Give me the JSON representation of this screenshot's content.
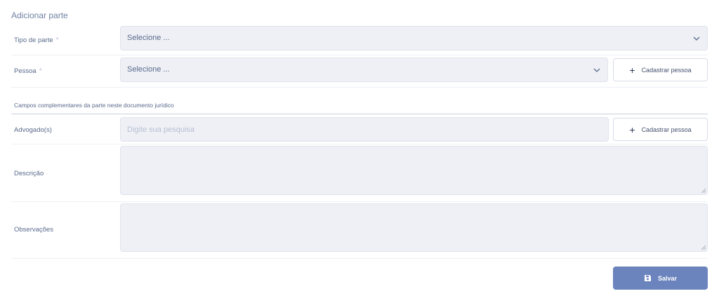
{
  "title": "Adicionar parte",
  "tipo_parte": {
    "label": "Tipo de parte",
    "required_mark": "*",
    "value": "Selecione ..."
  },
  "pessoa": {
    "label": "Pessoa",
    "required_mark": "*",
    "value": "Selecione ...",
    "add_button": "Cadastrar pessoa"
  },
  "section_title": "Campos complementares da parte neste documento jurídico",
  "advogados": {
    "label": "Advogado(s)",
    "placeholder": "Digite sua pesquisa",
    "add_button": "Cadastrar pessoa"
  },
  "descricao": {
    "label": "Descrição",
    "value": ""
  },
  "observacoes": {
    "label": "Observações",
    "value": ""
  },
  "save_button": "Salvar",
  "colors": {
    "primary": "#6b84bd",
    "field_bg": "#eef0f5",
    "text": "#5a6a8c"
  }
}
